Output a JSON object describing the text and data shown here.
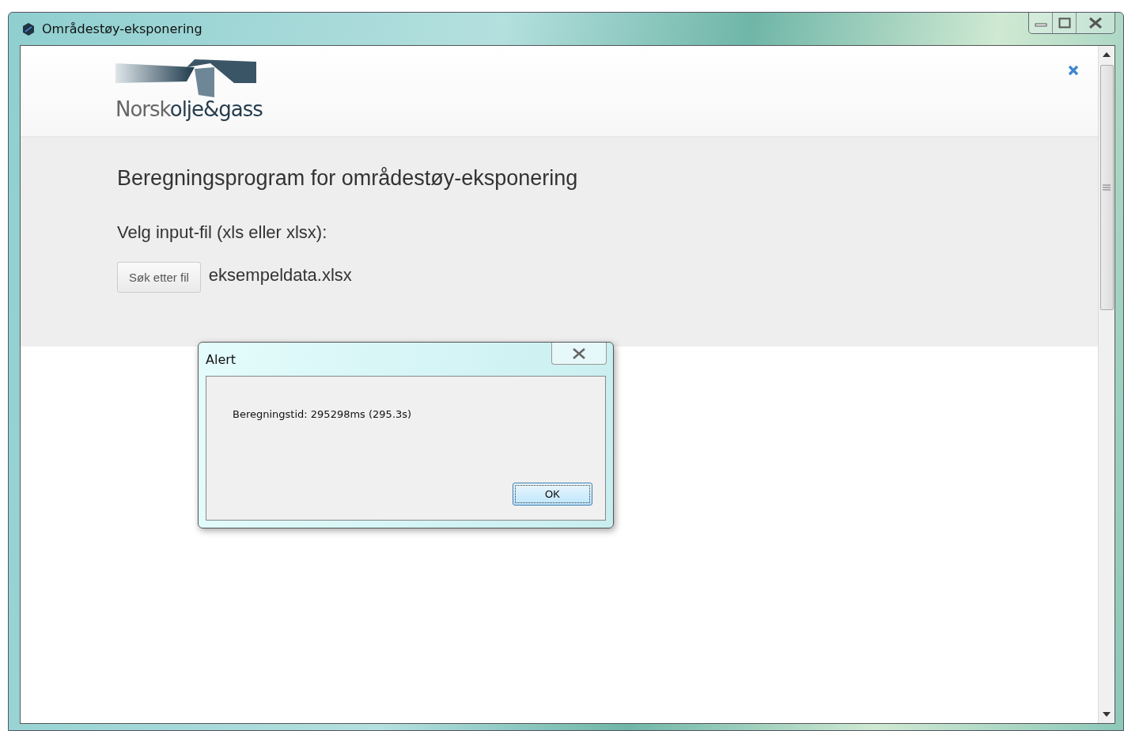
{
  "window": {
    "title": "Områdestøy-eksponering"
  },
  "logo": {
    "part_1": "Norsk",
    "part_2": "olje&gass"
  },
  "heading": "Beregningsprogram for områdestøy-eksponering",
  "file_label": "Velg input-fil (xls eller xlsx):",
  "browse_button": "Søk etter fil",
  "file_name": "eksempeldata.xlsx",
  "alert": {
    "title": "Alert",
    "message": "Beregningstid: 295298ms (295.3s)",
    "buttons": [
      {
        "label": "OK",
        "selected": true
      }
    ]
  }
}
